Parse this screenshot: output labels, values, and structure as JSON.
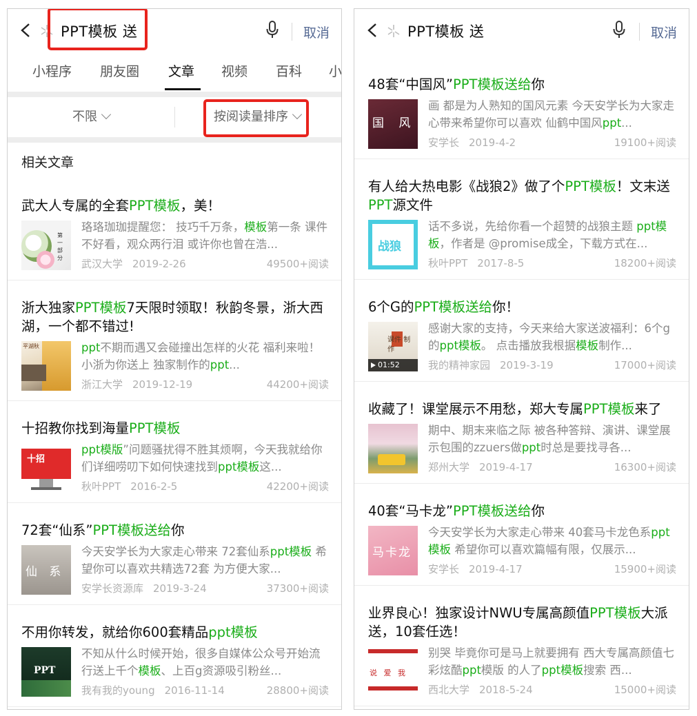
{
  "left": {
    "query": "PPT模板 送",
    "cancel": "取消",
    "tabs": [
      "小程序",
      "朋友圈",
      "文章",
      "视频",
      "百科",
      "小"
    ],
    "filters": {
      "range": "不限",
      "sort": "按阅读量排序"
    },
    "section_title": "相关文章",
    "articles": [
      {
        "title": [
          {
            "t": "武大人专属的全套"
          },
          {
            "t": "PPT模板",
            "hl": true
          },
          {
            "t": "，美！"
          }
        ],
        "summary": [
          {
            "t": "珞珞珈珈提醒您： 技巧千万条，"
          },
          {
            "t": "模板",
            "hl": true
          },
          {
            "t": "第一条 课件不好看，观众两行泪 或许你也曾在浩..."
          }
        ],
        "source": "武汉大学",
        "date": "2019-2-26",
        "reads": "49500+阅读",
        "thumb_text": "第 一 部 分"
      },
      {
        "title": [
          {
            "t": "浙大独家"
          },
          {
            "t": "PPT模板",
            "hl": true
          },
          {
            "t": "7天限时领取！秋韵冬景，浙大西湖，一个都不错过!"
          }
        ],
        "summary": [
          {
            "t": "ppt",
            "hl": true
          },
          {
            "t": "不期而遇又会碰撞出怎样的火花 福利来啦！ 小浙为你送上 独家制作的"
          },
          {
            "t": "ppt",
            "hl": true
          },
          {
            "t": "..."
          }
        ],
        "source": "浙江大学",
        "date": "2019-12-19",
        "reads": "44200+阅读",
        "thumb_text": "平湖秋"
      },
      {
        "title": [
          {
            "t": "十招教你找到海量"
          },
          {
            "t": "PPT模板",
            "hl": true
          }
        ],
        "summary": [
          {
            "t": "ppt模版",
            "hl": true
          },
          {
            "t": "”问题骚扰得不胜其烦啊，今天我就给你们详细唠叨下如何快速找到"
          },
          {
            "t": "ppt模板",
            "hl": true
          },
          {
            "t": "这..."
          }
        ],
        "source": "秋叶PPT",
        "date": "2016-2-5",
        "reads": "42200+阅读",
        "thumb_text": "十招"
      },
      {
        "title": [
          {
            "t": "72套“仙系”"
          },
          {
            "t": "PPT模板送给",
            "hl": true
          },
          {
            "t": "你"
          }
        ],
        "summary": [
          {
            "t": "今天安学长为大家走心带来 72套仙系"
          },
          {
            "t": "ppt模板",
            "hl": true
          },
          {
            "t": " 希望你可以喜欢共精选72套 为方便大家..."
          }
        ],
        "source": "安学长资源库",
        "date": "2019-3-24",
        "reads": "37300+阅读",
        "thumb_text": "仙 系"
      },
      {
        "title": [
          {
            "t": "不用你转发，就给你600套精品"
          },
          {
            "t": "ppt模板",
            "hl": true
          }
        ],
        "summary": [
          {
            "t": "不知从什么时候开始，很多自媒体公众号开始流行送上千个"
          },
          {
            "t": "模板",
            "hl": true
          },
          {
            "t": "、上百g资源吸引粉丝..."
          }
        ],
        "source": "我有我的young",
        "date": "2016-11-14",
        "reads": "28800+阅读",
        "thumb_text": "PPT"
      }
    ]
  },
  "right": {
    "query": "PPT模板 送",
    "cancel": "取消",
    "articles": [
      {
        "title": [
          {
            "t": "48套“中国风”"
          },
          {
            "t": "PPT模板送给",
            "hl": true
          },
          {
            "t": "你"
          }
        ],
        "summary": [
          {
            "t": "画 都是为人熟知的国风元素 今天安学长为大家走心带来希望你可以喜欢 仙鹤中国风"
          },
          {
            "t": "ppt",
            "hl": true
          },
          {
            "t": "..."
          }
        ],
        "source": "安学长",
        "date": "2019-4-2",
        "reads": "19100+阅读",
        "thumb_text": "国 风"
      },
      {
        "title": [
          {
            "t": "有人给大热电影《战狼2》做了个"
          },
          {
            "t": "PPT模板",
            "hl": true
          },
          {
            "t": "！文末送"
          },
          {
            "t": "PPT",
            "hl": true
          },
          {
            "t": "源文件"
          }
        ],
        "summary": [
          {
            "t": "话不多说，先给你看一个超赞的战狼主题 "
          },
          {
            "t": "ppt模板",
            "hl": true
          },
          {
            "t": "，作者是 @promise成全，下载方式在..."
          }
        ],
        "source": "秋叶PPT",
        "date": "2017-8-5",
        "reads": "18200+阅读",
        "thumb_text": "战狼"
      },
      {
        "title": [
          {
            "t": "6个G的"
          },
          {
            "t": "PPT模板送给",
            "hl": true
          },
          {
            "t": "你！"
          }
        ],
        "summary": [
          {
            "t": "感谢大家的支持，今天来给大家送波福利：6个g的"
          },
          {
            "t": "ppt模板",
            "hl": true
          },
          {
            "t": "。 点击播放我根据"
          },
          {
            "t": "模板",
            "hl": true
          },
          {
            "t": "制作..."
          }
        ],
        "source": "我的精神家园",
        "date": "2019-3-19",
        "reads": "17000+阅读",
        "thumb_text": "课件 制作",
        "video_duration": "01:52"
      },
      {
        "title": [
          {
            "t": "收藏了！课堂展示不用愁，郑大专属"
          },
          {
            "t": "PPT模板",
            "hl": true
          },
          {
            "t": "来了"
          }
        ],
        "summary": [
          {
            "t": "期中、期末来临之际 被各种答辩、演讲、课堂展示包围的zzuers做"
          },
          {
            "t": "ppt",
            "hl": true
          },
          {
            "t": "时总是要找寻各..."
          }
        ],
        "source": "郑州大学",
        "date": "2019-4-17",
        "reads": "16300+阅读",
        "thumb_text": ""
      },
      {
        "title": [
          {
            "t": "40套“马卡龙”"
          },
          {
            "t": "PPT模板送给",
            "hl": true
          },
          {
            "t": "你"
          }
        ],
        "summary": [
          {
            "t": "今天安学长为大家走心带来 40套马卡龙色系"
          },
          {
            "t": "ppt模板",
            "hl": true
          },
          {
            "t": " 希望你可以喜欢篇幅有限，仅展示..."
          }
        ],
        "source": "安学长",
        "date": "2019-4-17",
        "reads": "15900+阅读",
        "thumb_text": "马卡龙"
      },
      {
        "title": [
          {
            "t": "业界良心！独家设计NWU专属高颜值"
          },
          {
            "t": "PPT模板",
            "hl": true
          },
          {
            "t": "大派送，10套任选！"
          }
        ],
        "summary": [
          {
            "t": "别哭 毕竟你可是马上就要拥有 西大专属高颜值七彩炫酷"
          },
          {
            "t": "ppt",
            "hl": true
          },
          {
            "t": "模版 的人了"
          },
          {
            "t": "ppt模板",
            "hl": true
          },
          {
            "t": "搜索 西..."
          }
        ],
        "source": "西北大学",
        "date": "2018-5-24",
        "reads": "15000+阅读",
        "thumb_text": "说 爱 我"
      }
    ]
  }
}
